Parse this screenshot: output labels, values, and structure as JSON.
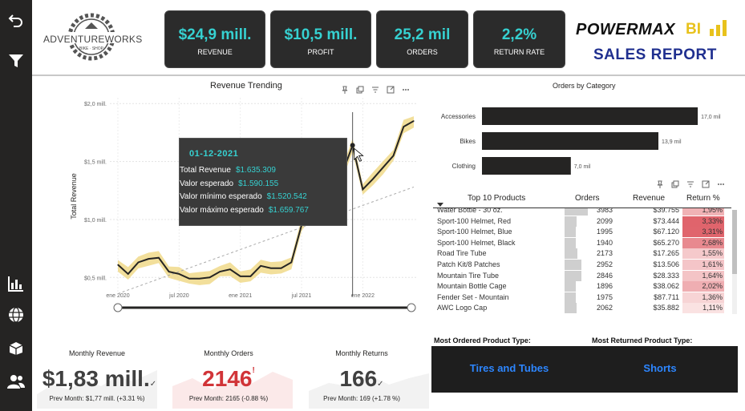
{
  "rail": {
    "icons": [
      "back-arrow-icon",
      "filter-icon",
      "bar-chart-icon",
      "globe-icon",
      "box-icon",
      "users-icon"
    ]
  },
  "logo": {
    "text": "ADVENTUREWORKS",
    "sub": "BIKE · SHOP"
  },
  "kpis": [
    {
      "value": "$24,9 mill.",
      "label": "REVENUE"
    },
    {
      "value": "$10,5 mill.",
      "label": "PROFIT"
    },
    {
      "value": "25,2 mil",
      "label": "ORDERS"
    },
    {
      "value": "2,2%",
      "label": "RETURN RATE"
    }
  ],
  "brand": {
    "line1": "POWERMAX",
    "bi": "BI",
    "line2": "SALES REPORT"
  },
  "revenue_chart": {
    "title": "Revenue Trending",
    "ylabel": "Total Revenue",
    "y_ticks": [
      "$2,0 mill.",
      "$1,5 mill.",
      "$1,0 mill.",
      "$0,5 mill."
    ],
    "x_ticks": [
      "ene 2020",
      "jul 2020",
      "ene 2021",
      "jul 2021",
      "ene 2022"
    ]
  },
  "tooltip": {
    "date": "01-12-2021",
    "rows": [
      {
        "key": "Total Revenue",
        "value": "$1.635.309"
      },
      {
        "key": "Valor esperado",
        "value": "$1.590.155"
      },
      {
        "key": "Valor mínimo esperado",
        "value": "$1.520.542"
      },
      {
        "key": "Valor máximo esperado",
        "value": "$1.659.767"
      }
    ]
  },
  "category_chart": {
    "title": "Orders by Category",
    "labels": [
      "17,0 mil",
      "13,9 mil",
      "7,0 mil"
    ]
  },
  "top_products": {
    "headers": {
      "product": "Top 10 Products",
      "orders": "Orders",
      "revenue": "Revenue",
      "return": "Return %"
    },
    "rows": [
      {
        "product": "Water Bottle - 30 oz.",
        "orders": "3983",
        "revenue": "$39.755",
        "ret": "1,95%",
        "ret_num": 1.95
      },
      {
        "product": "Sport-100 Helmet, Red",
        "orders": "2099",
        "revenue": "$73.444",
        "ret": "3,33%",
        "ret_num": 3.33
      },
      {
        "product": "Sport-100 Helmet, Blue",
        "orders": "1995",
        "revenue": "$67.120",
        "ret": "3,31%",
        "ret_num": 3.31
      },
      {
        "product": "Sport-100 Helmet, Black",
        "orders": "1940",
        "revenue": "$65.270",
        "ret": "2,68%",
        "ret_num": 2.68
      },
      {
        "product": "Road Tire Tube",
        "orders": "2173",
        "revenue": "$17.265",
        "ret": "1,55%",
        "ret_num": 1.55
      },
      {
        "product": "Patch Kit/8 Patches",
        "orders": "2952",
        "revenue": "$13.506",
        "ret": "1,61%",
        "ret_num": 1.61
      },
      {
        "product": "Mountain Tire Tube",
        "orders": "2846",
        "revenue": "$28.333",
        "ret": "1,64%",
        "ret_num": 1.64
      },
      {
        "product": "Mountain Bottle Cage",
        "orders": "1896",
        "revenue": "$38.062",
        "ret": "2,02%",
        "ret_num": 2.02
      },
      {
        "product": "Fender Set - Mountain",
        "orders": "1975",
        "revenue": "$87.711",
        "ret": "1,36%",
        "ret_num": 1.36
      },
      {
        "product": "AWC Logo Cap",
        "orders": "2062",
        "revenue": "$35.882",
        "ret": "1,11%",
        "ret_num": 1.11
      }
    ]
  },
  "most": {
    "ordered_title": "Most Ordered Product Type:",
    "returned_title": "Most Returned Product Type:",
    "ordered_value": "Tires and Tubes",
    "returned_value": "Shorts"
  },
  "cards": [
    {
      "title": "Monthly Revenue",
      "value": "$1,83 mill.",
      "mark": "✓",
      "sub": "Prev Month: $1,77 mill. (+3.31 %)",
      "color": "#404040"
    },
    {
      "title": "Monthly Orders",
      "value": "2146",
      "mark": "!",
      "sub": "Prev Month: 2165 (-0.88 %)",
      "color": "#d13438"
    },
    {
      "title": "Monthly Returns",
      "value": "166",
      "mark": "✓",
      "sub": "Prev Month: 169 (+1.78 %)",
      "color": "#404040"
    }
  ],
  "chart_data": [
    {
      "type": "line",
      "title": "Revenue Trending",
      "ylabel": "Total Revenue",
      "ylim": [
        0.35,
        2.05
      ],
      "x": [
        "2020-01",
        "2020-02",
        "2020-03",
        "2020-04",
        "2020-05",
        "2020-06",
        "2020-07",
        "2020-08",
        "2020-09",
        "2020-10",
        "2020-11",
        "2020-12",
        "2021-01",
        "2021-02",
        "2021-03",
        "2021-04",
        "2021-05",
        "2021-06",
        "2021-07",
        "2021-08",
        "2021-09",
        "2021-10",
        "2021-11",
        "2021-12",
        "2022-01",
        "2022-02",
        "2022-03",
        "2022-04",
        "2022-05",
        "2022-06"
      ],
      "series": [
        {
          "values": [
            0.61,
            0.53,
            0.63,
            0.66,
            0.67,
            0.55,
            0.53,
            0.49,
            0.49,
            0.5,
            0.55,
            0.57,
            0.51,
            0.51,
            0.6,
            0.58,
            0.58,
            0.63,
            0.95,
            1.08,
            1.22,
            1.23,
            1.4,
            1.64,
            1.26,
            1.35,
            1.45,
            1.55,
            1.8,
            1.85
          ]
        }
      ]
    },
    {
      "type": "bar",
      "title": "Orders by Category",
      "categories": [
        "Accessories",
        "Bikes",
        "Clothing"
      ],
      "values": [
        17.0,
        13.9,
        7.0
      ],
      "xlim": [
        0,
        17.5
      ]
    }
  ]
}
